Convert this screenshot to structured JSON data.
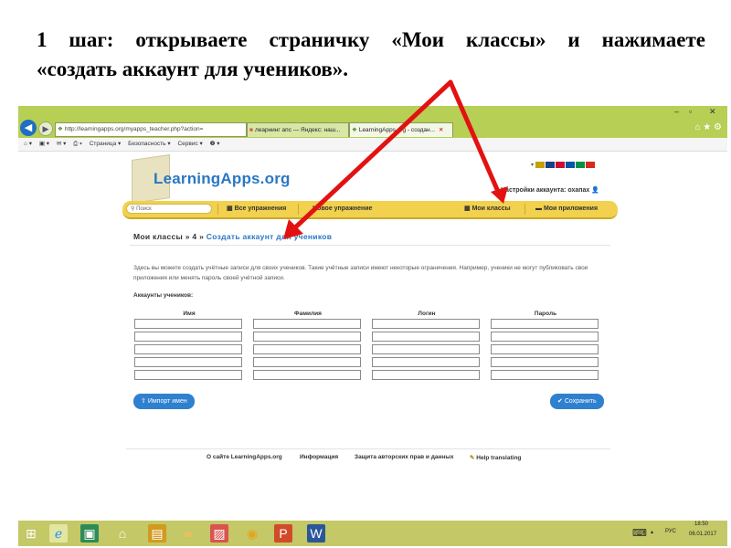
{
  "slide": {
    "title_line1_words": [
      "1",
      "шаг:",
      "открываете",
      "страничку",
      "«Мои",
      "классы»",
      "и",
      "нажимаете"
    ],
    "title_line2": "«создать аккаунт для учеников»."
  },
  "browser": {
    "window_controls": [
      "–",
      "▫",
      "✕"
    ],
    "back_icon": "back-arrow-icon",
    "forward_icon": "forward-arrow-icon",
    "address": "http://learningapps.org/myapps_teacher.php?action=",
    "address_icons": "ρ ▾ C",
    "tabs": [
      {
        "label": "леарнинг апс — Яндекс: наш...",
        "icon_color": "#d9534f"
      },
      {
        "label": "LearningApps.org - создан...",
        "close": "✕"
      }
    ],
    "toolbar_right": "⌂ ★ ⚙",
    "command_bar": [
      "Страница ▾",
      "Безопасность ▾",
      "Сервис ▾",
      "❷ ▾"
    ]
  },
  "site": {
    "logo": "LearningApps.org",
    "flags": [
      "#c8a000",
      "#1b3f8a",
      "#c8102e",
      "#0055a4",
      "#009246",
      "#d52b1e"
    ],
    "account": "Настройки аккаунта: охапах",
    "search_placeholder": "Поиск",
    "menu": {
      "all_exercises": "Все упражнения",
      "new_exercise": "Новое упражнение",
      "my_classes": "Мои классы",
      "my_apps": "Мои приложения"
    },
    "breadcrumb": {
      "part1": "Мои классы » 4 » ",
      "link": "Создать аккаунт для учеников"
    },
    "description": "Здесь вы можете создать учётные записи для своих учеников. Такие учётные записи имеют некоторые ограничения. Например, ученики не могут публиковать свои приложения или менять пароль своей учётной записи.",
    "students_label": "Аккаунты учеников:",
    "columns": [
      "Имя",
      "Фамилия",
      "Логин",
      "Пароль"
    ],
    "row_count": 5,
    "import_button": "Импорт имен",
    "save_button": "Сохранить",
    "footer": {
      "about": "О сайте LearningApps.org",
      "info": "Информация",
      "copyright": "Защита авторских прав и данных",
      "help": "Help translating"
    }
  },
  "taskbar": {
    "apps": [
      "windows-start-icon",
      "internet-explorer-icon",
      "store-icon",
      "home-icon",
      "notes-icon",
      "folder-icon",
      "image-icon",
      "chrome-icon",
      "powerpoint-icon",
      "word-icon"
    ],
    "tray_lang": "РУС",
    "time": "18:50",
    "date": "06.01.2017"
  }
}
